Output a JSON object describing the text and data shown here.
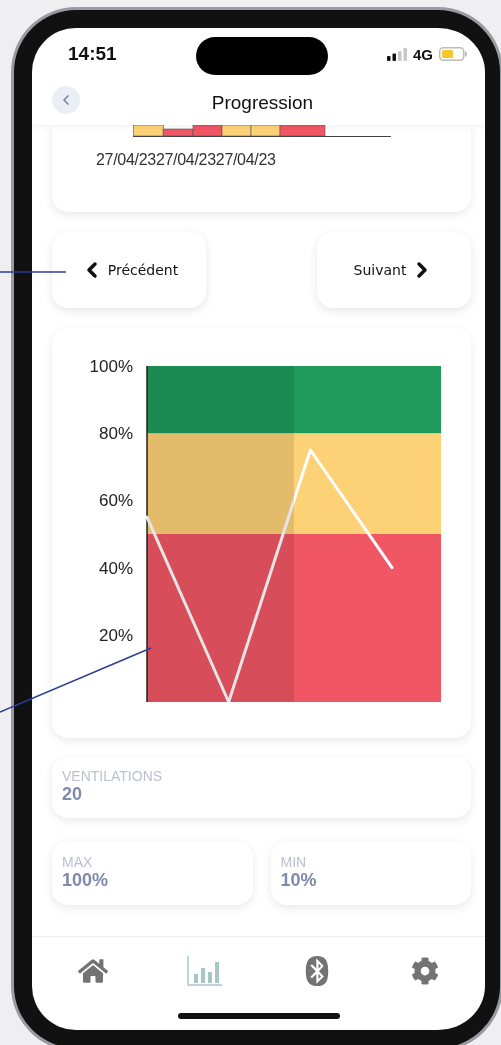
{
  "status_bar": {
    "time": "14:51",
    "network": "4G"
  },
  "header": {
    "title": "Progression"
  },
  "history_chart": {
    "date_labels": [
      "27/04/23",
      "27/04/23",
      "27/04/23"
    ]
  },
  "navigation": {
    "previous": "Précédent",
    "next": "Suivant"
  },
  "chart": {
    "chart_data": {
      "type": "line",
      "categories": [
        null,
        null,
        null,
        null
      ],
      "ylim": [
        0,
        100
      ],
      "yticks": [
        {
          "value": 20,
          "label": "20%"
        },
        {
          "value": 40,
          "label": "40%"
        },
        {
          "value": 60,
          "label": "60%"
        },
        {
          "value": 80,
          "label": "80%"
        },
        {
          "value": 100,
          "label": "100%"
        }
      ],
      "series": [
        {
          "color": "#ffffff",
          "values": [
            55,
            0,
            75,
            40
          ]
        }
      ],
      "bands": [
        {
          "axis": "y",
          "from": 0,
          "to": 50,
          "color": "#f05664"
        },
        {
          "axis": "y",
          "from": 50,
          "to": 80,
          "color": "#fdd176"
        },
        {
          "axis": "y",
          "from": 80,
          "to": 100,
          "color": "#209a5b"
        }
      ]
    }
  },
  "stats": [
    {
      "kind": "wide",
      "label": "VENTILATIONS",
      "value": "20"
    },
    {
      "kind": "half",
      "label": "MAX",
      "value": "100%"
    },
    {
      "kind": "half",
      "label": "MIN",
      "value": "10%"
    }
  ],
  "tab_bar": [
    {
      "kind": "home",
      "selected": false
    },
    {
      "kind": "chart",
      "selected": true
    },
    {
      "kind": "bluetooth",
      "selected": false
    },
    {
      "kind": "settings",
      "selected": false
    }
  ]
}
